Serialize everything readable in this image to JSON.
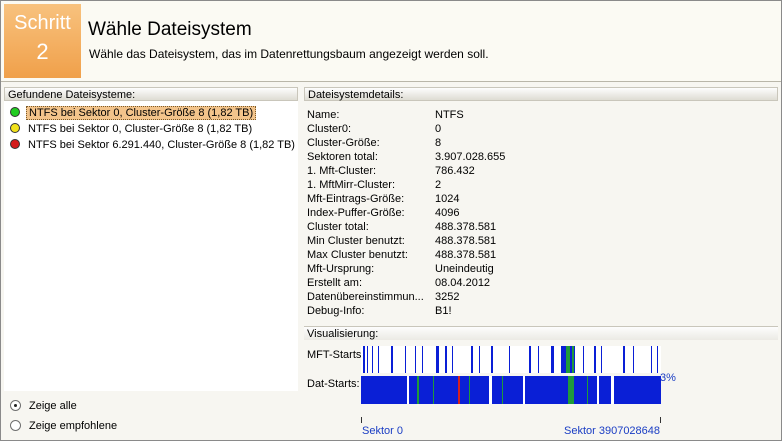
{
  "header": {
    "step_line1": "Schritt",
    "step_line2": "2",
    "title": "Wähle Dateisystem",
    "description": "Wähle das Dateisystem, das im Datenrettungsbaum angezeigt werden soll."
  },
  "left_panel": {
    "title": "Gefundene Dateisysteme:",
    "items": [
      {
        "label": "NTFS bei Sektor 0, Cluster-Größe 8 (1,82 TB)",
        "status_color": "#22cc22",
        "selected": true
      },
      {
        "label": "NTFS bei Sektor 0, Cluster-Größe 8 (1,82 TB)",
        "status_color": "#f2e21c",
        "selected": false
      },
      {
        "label": "NTFS bei Sektor 6.291.440, Cluster-Größe 8 (1,82 TB)",
        "status_color": "#d41c1c",
        "selected": false
      }
    ]
  },
  "filter": {
    "options": [
      {
        "label": "Zeige alle",
        "checked": true
      },
      {
        "label": "Zeige empfohlene",
        "checked": false
      }
    ]
  },
  "details": {
    "title": "Dateisystemdetails:",
    "rows": [
      {
        "key": "Name:",
        "value": "NTFS"
      },
      {
        "key": "Cluster0:",
        "value": "0"
      },
      {
        "key": "Cluster-Größe:",
        "value": "8"
      },
      {
        "key": "Sektoren total:",
        "value": "3.907.028.655"
      },
      {
        "key": "1. Mft-Cluster:",
        "value": "786.432"
      },
      {
        "key": "1. MftMirr-Cluster:",
        "value": "2"
      },
      {
        "key": "Mft-Eintrags-Größe:",
        "value": "1024"
      },
      {
        "key": "Index-Puffer-Größe:",
        "value": "4096"
      },
      {
        "key": "Cluster total:",
        "value": "488.378.581"
      },
      {
        "key": "Min Cluster benutzt:",
        "value": "488.378.581"
      },
      {
        "key": "Max Cluster benutzt:",
        "value": "488.378.581"
      },
      {
        "key": "Mft-Ursprung:",
        "value": "Uneindeutig"
      },
      {
        "key": "Erstellt am:",
        "value": "08.04.2012"
      },
      {
        "key": "Datenübereinstimmun...",
        "value": "3252"
      },
      {
        "key": "Debug-Info:",
        "value": "B1!"
      }
    ]
  },
  "visualization": {
    "title": "Visualisierung:",
    "mft_label": "MFT-Starts",
    "dat_label": "Dat-Starts:",
    "percent": "3%",
    "sector_start": "Sektor 0",
    "sector_end": "Sektor 3907028648",
    "colors": {
      "blue": "#0a1fd6",
      "green": "#1f9a3a",
      "red": "#d42020"
    }
  }
}
